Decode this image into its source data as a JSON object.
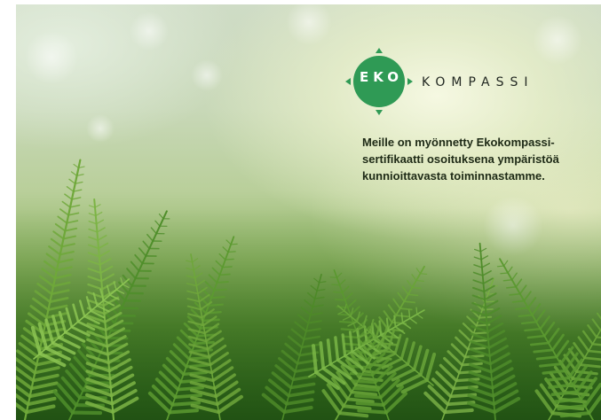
{
  "brand": {
    "eko": "EKO",
    "kompassi": "KOMPASSI",
    "circle_color": "#2f9a55",
    "arrow_color": "#2f9a55"
  },
  "statement": {
    "lines": [
      "Meille on myönnetty Ekokompassi-",
      "sertifikaatti osoituksena ympäristöä",
      "kunnioittavasta toiminnastamme."
    ]
  },
  "image": {
    "subject": "fern-forest-background-icon"
  }
}
